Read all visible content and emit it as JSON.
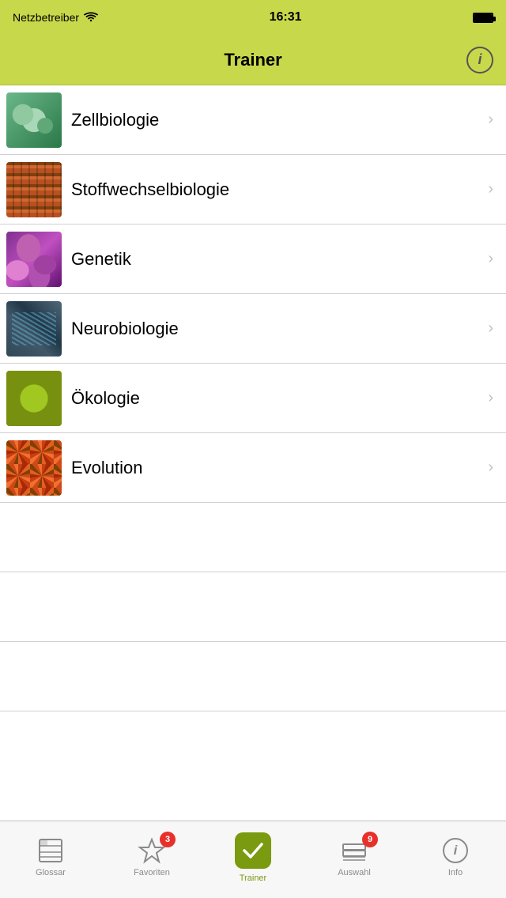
{
  "statusBar": {
    "carrier": "Netzbetreiber",
    "time": "16:31"
  },
  "navBar": {
    "title": "Trainer",
    "infoButton": "i"
  },
  "listItems": [
    {
      "id": "zellbiologie",
      "label": "Zellbiologie",
      "thumbClass": "thumb-zell"
    },
    {
      "id": "stoffwechselbiologie",
      "label": "Stoffwechselbiologie",
      "thumbClass": "thumb-stoff"
    },
    {
      "id": "genetik",
      "label": "Genetik",
      "thumbClass": "thumb-genetik"
    },
    {
      "id": "neurobiologie",
      "label": "Neurobiologie",
      "thumbClass": "thumb-neuro"
    },
    {
      "id": "oekologie",
      "label": "Ökologie",
      "thumbClass": "thumb-oeko"
    },
    {
      "id": "evolution",
      "label": "Evolution",
      "thumbClass": "thumb-evol"
    }
  ],
  "tabBar": {
    "items": [
      {
        "id": "glossar",
        "label": "Glossar",
        "icon": "glossar-icon",
        "active": false,
        "badge": null
      },
      {
        "id": "favoriten",
        "label": "Favoriten",
        "icon": "star-icon",
        "active": false,
        "badge": "3"
      },
      {
        "id": "trainer",
        "label": "Trainer",
        "icon": "check-icon",
        "active": true,
        "badge": null
      },
      {
        "id": "auswahl",
        "label": "Auswahl",
        "icon": "stack-icon",
        "active": false,
        "badge": "9"
      },
      {
        "id": "info",
        "label": "Info",
        "icon": "info-icon",
        "active": false,
        "badge": null
      }
    ]
  }
}
